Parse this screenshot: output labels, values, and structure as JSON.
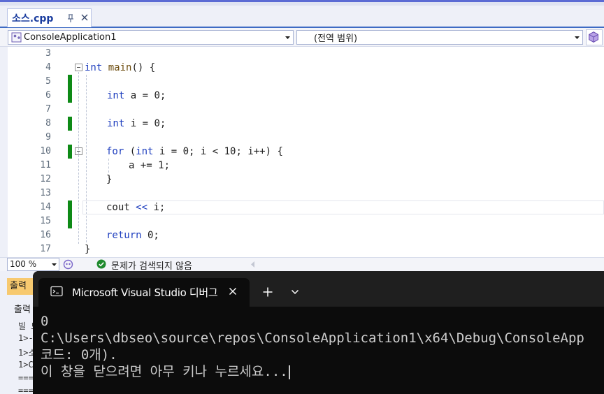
{
  "document_tab": {
    "name": "소스.cpp"
  },
  "navbar": {
    "project": "ConsoleApplication1",
    "scope": "(전역 범위)"
  },
  "editor": {
    "line_numbers": [
      "3",
      "4",
      "5",
      "6",
      "7",
      "8",
      "9",
      "10",
      "11",
      "12",
      "13",
      "14",
      "15",
      "16",
      "17"
    ],
    "code": [
      "",
      "int main() {",
      "",
      "int a = 0;",
      "",
      "int i = 0;",
      "",
      "for (int i = 0; i < 10; i++) {",
      "a += 1;",
      "}",
      "",
      "cout << i;",
      "",
      "return 0;",
      "}"
    ]
  },
  "statusbar": {
    "zoom": "100 %",
    "issues": "문제가 검색되지 않음"
  },
  "output_panel": {
    "tab": "출력",
    "sub": "출력",
    "lines": [
      "빌 드",
      "1>-",
      "1>소",
      "1>C",
      "===",
      "==="
    ]
  },
  "terminal": {
    "tab_title": "Microsoft Visual Studio 디버그",
    "lines": [
      "0",
      "C:\\Users\\dbseo\\source\\repos\\ConsoleApplication1\\x64\\Debug\\ConsoleApp",
      "코드: 0개).",
      "이 창을 닫으려면 아무 키나 누르세요..."
    ]
  },
  "colors": {
    "keyword": "#1f3fbf",
    "change_bar": "#0e8a16",
    "terminal_bg": "#0c0c0c",
    "tab_accent": "#3e6bc4"
  },
  "icons": [
    "pin-icon",
    "close-icon",
    "project-icon",
    "chevron-down-icon",
    "cube-icon",
    "copilot-icon",
    "check-icon",
    "terminal-icon",
    "plus-icon"
  ]
}
